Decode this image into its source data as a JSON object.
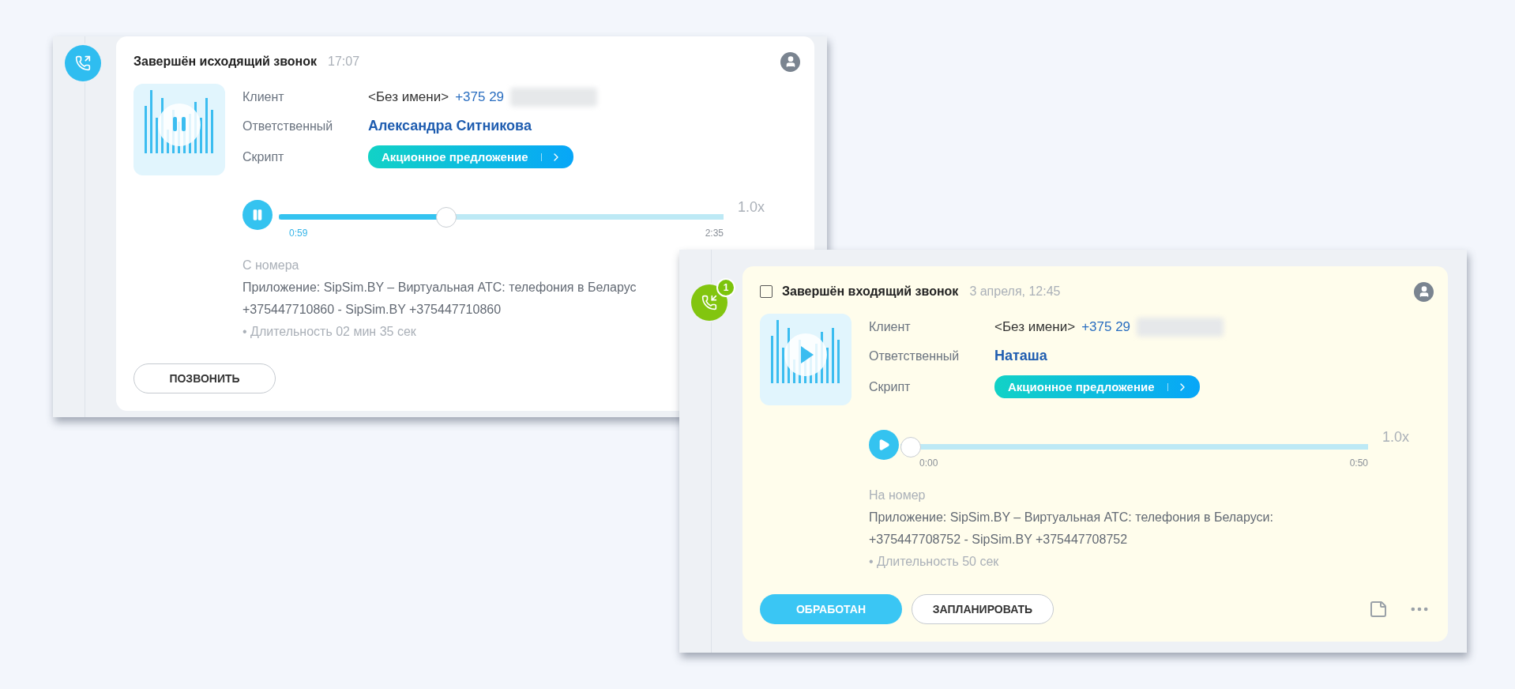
{
  "windows": [
    {
      "kind": "outgoing",
      "title": "Завершён исходящий звонок",
      "time": "17:07",
      "client_label": "Клиент",
      "client_name": "<Без имени>",
      "client_phone": "+375 29",
      "responsible_label": "Ответственный",
      "responsible": "Александра Ситникова",
      "script_label": "Скрипт",
      "script": "Акционное предложение",
      "player": {
        "playing": true,
        "level": 0.37,
        "current": "0:59",
        "total": "2:35",
        "speed": "1.0x"
      },
      "info_label": "С номера",
      "info_lines": [
        "Приложение: SipSim.BY – Виртуальная АТС: телефония в Беларус",
        "+375447710860 - SipSim.BY +375447710860"
      ],
      "duration": "• Длительность 02 мин 35 сек",
      "buttons": [
        {
          "label": "ПОЗВОНИТЬ",
          "kind": "outline"
        }
      ]
    },
    {
      "kind": "incoming",
      "badge": "1",
      "checkbox": {
        "checked": false
      },
      "title": "Завершён входящий звонок",
      "time": "3 апреля, 12:45",
      "client_label": "Клиент",
      "client_name": "<Без имени>",
      "client_phone": "+375 29",
      "responsible_label": "Ответственный",
      "responsible": "Наташа",
      "script_label": "Скрипт",
      "script": "Акционное предложение",
      "player": {
        "playing": false,
        "level": 0,
        "current": "0:00",
        "total": "0:50",
        "speed": "1.0x"
      },
      "info_label": "На номер",
      "info_lines": [
        "Приложение: SipSim.BY – Виртуальная АТС: телефония в Беларуси:",
        "+375447708752 - SipSim.BY +375447708752"
      ],
      "duration": "• Длительность 50 сек",
      "buttons": [
        {
          "label": "ОБРАБОТАН",
          "kind": "primary"
        },
        {
          "label": "ЗАПЛАНИРОВАТЬ",
          "kind": "outline"
        }
      ],
      "tools": true
    }
  ]
}
